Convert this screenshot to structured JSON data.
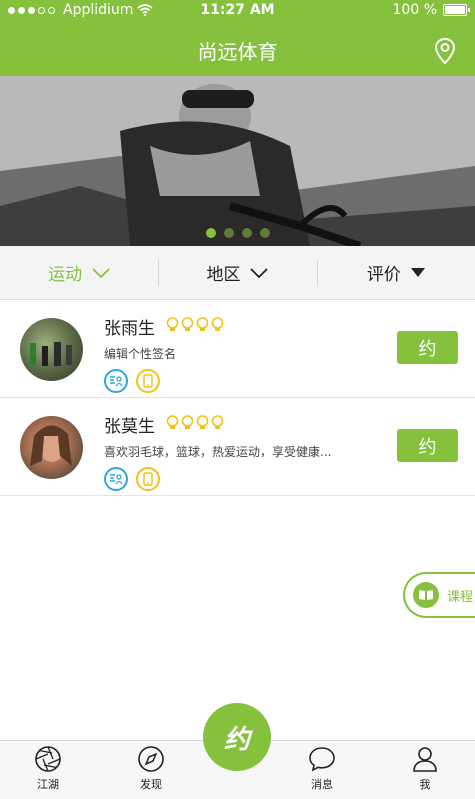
{
  "status": {
    "carrier": "Applidium",
    "time": "11:27 AM",
    "battery": "100 %",
    "battery_level": 1.0
  },
  "nav": {
    "title": "尚远体育"
  },
  "banner": {
    "page_count": 4,
    "active_index": 0
  },
  "filters": [
    {
      "label": "运动"
    },
    {
      "label": "地区"
    },
    {
      "label": "评价"
    }
  ],
  "users": [
    {
      "name": "张雨生",
      "bio": "编辑个性签名",
      "rating": 4,
      "action": "约"
    },
    {
      "name": "张莫生",
      "bio": "喜欢羽毛球，篮球，热爱运动，享受健康...",
      "rating": 4,
      "action": "约"
    }
  ],
  "course": {
    "label": "课程"
  },
  "tabs": [
    {
      "label": "江湖"
    },
    {
      "label": "发现"
    },
    {
      "label": "消息"
    },
    {
      "label": "我"
    }
  ],
  "center_tab": {
    "glyph": "约"
  },
  "colors": {
    "accent": "#86c13e",
    "tag_blue": "#2ea5e0",
    "tag_yellow": "#f3c11c"
  }
}
